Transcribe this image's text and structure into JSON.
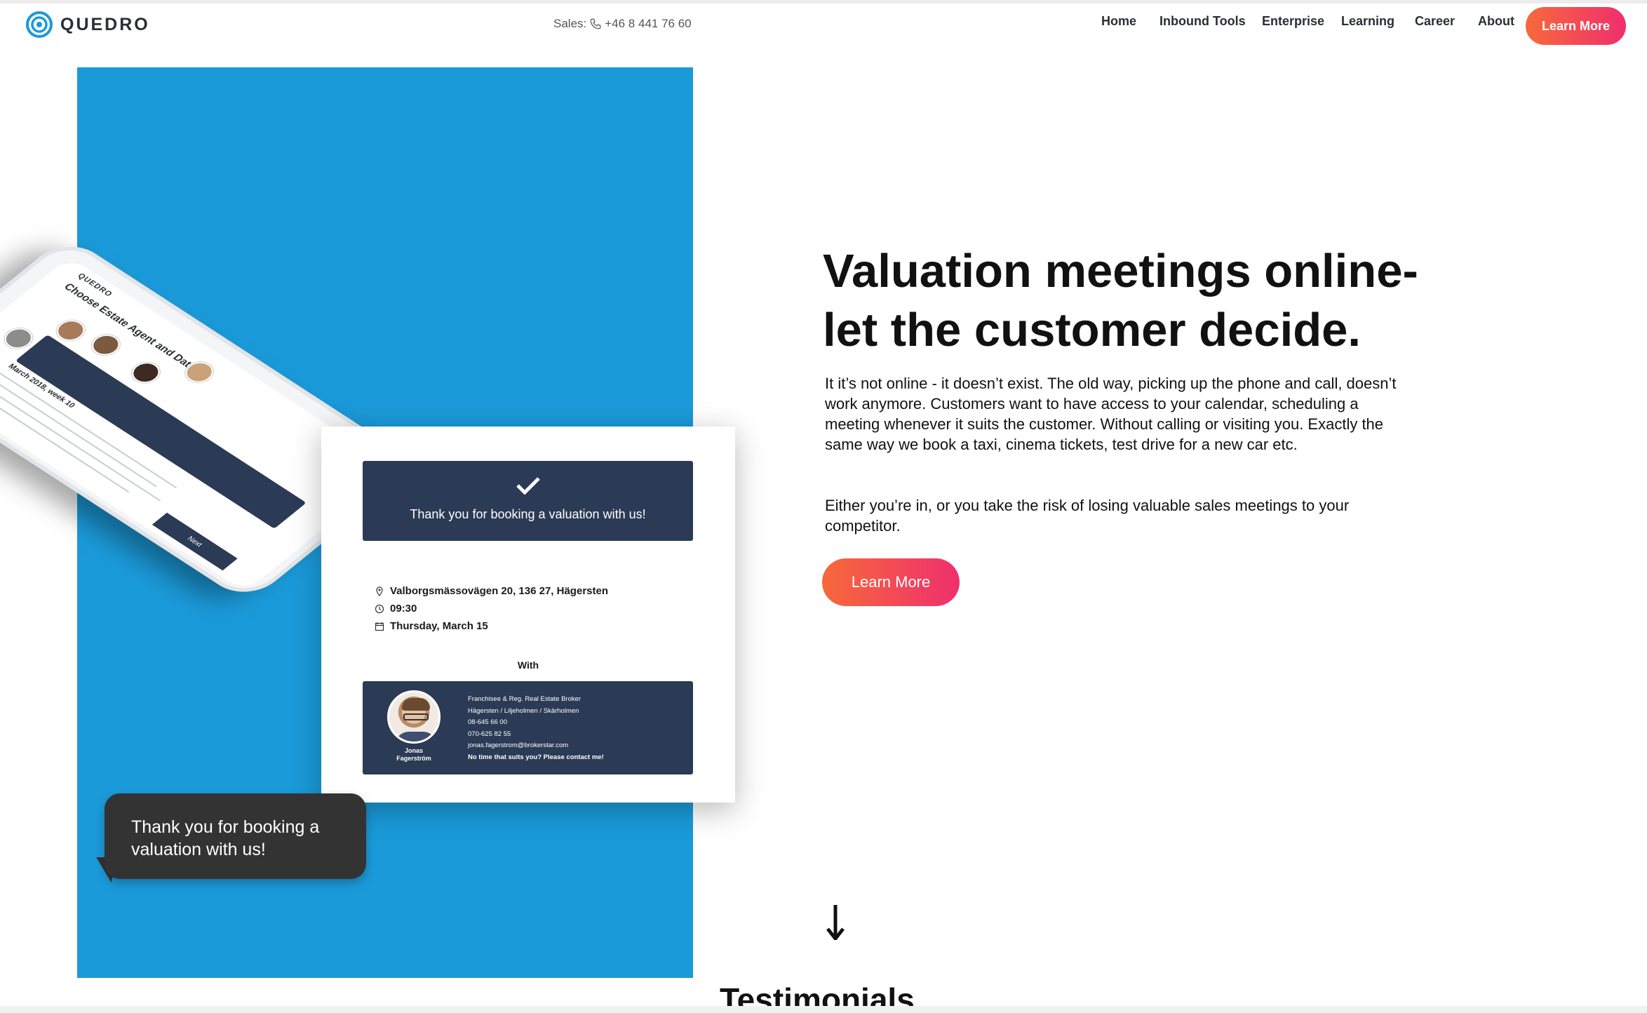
{
  "brand": {
    "name": "QUEDRO"
  },
  "header": {
    "sales_label": "Sales:",
    "sales_phone": "+46 8 441 76 60",
    "nav": [
      "Home",
      "Inbound Tools",
      "Enterprise",
      "Learning",
      "Career",
      "About"
    ],
    "cta_label": "Learn More"
  },
  "phone_mockup": {
    "brand": "QUEDRO",
    "title": "Choose Estate Agent and Date",
    "calendar_label": "March 2018, week 10",
    "next_label": "Next"
  },
  "confirmation": {
    "title": "Thank you for booking a valuation with us!",
    "address": "Valborgsmässovägen 20, 136 27, Hägersten",
    "time": "09:30",
    "date": "Thursday, March 15",
    "with_label": "With",
    "agent": {
      "first_name": "Jonas",
      "last_name": "Fagerström",
      "role": "Franchisee & Reg. Real Estate Broker",
      "area": "Hägersten / Liljeholmen / Skärholmen",
      "phone1": "08-645 66 00",
      "phone2": "070-625 82 55",
      "email": "jonas.fagerstrom@brokerstar.com",
      "note": "No time that suits you? Please contact me!"
    }
  },
  "bubble": {
    "line1": "Thank you for booking a",
    "line2": "valuation with us!"
  },
  "hero": {
    "headline_line1": "Valuation meetings online-",
    "headline_line2": "let the customer decide.",
    "paragraph1": "It it’s not online - it doesn’t exist. The old way, picking up the phone and call, doesn’t work anymore. Customers want to have access to your calendar, scheduling a meeting whenever it suits the customer. Without calling or visiting you. Exactly the same way we book a taxi, cinema tickets, test drive for a new car etc.",
    "paragraph2": "Either you’re in, or you take the risk of losing valuable sales meetings to your competitor.",
    "cta_label": "Learn More"
  },
  "next_section": {
    "title": "Testimonials"
  },
  "colors": {
    "blue_panel": "#1b9ad9",
    "navy_card": "#2b3a55",
    "cta_start": "#f7693a",
    "cta_end": "#ef2f6e",
    "bubble": "#333333"
  },
  "icons": {
    "logo": "quedro-logo-icon",
    "phone": "phone-icon",
    "location": "location-pin-icon",
    "clock": "clock-icon",
    "calendar": "calendar-icon",
    "check": "checkmark-icon",
    "arrow": "arrow-down-icon"
  }
}
